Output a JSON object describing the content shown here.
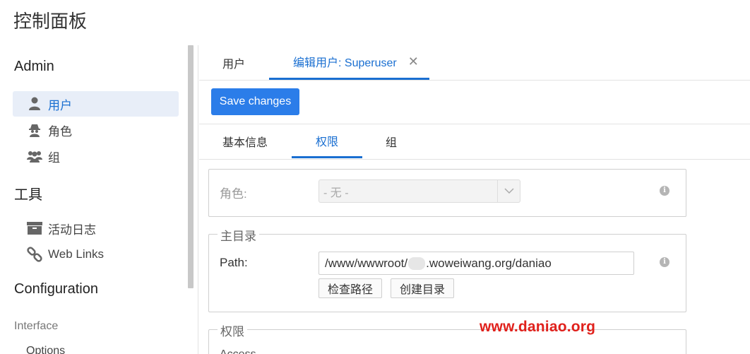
{
  "page": {
    "title": "控制面板"
  },
  "sidebar": {
    "admin_heading": "Admin",
    "items": [
      {
        "label": "用户",
        "icon": "user-icon",
        "active": true
      },
      {
        "label": "角色",
        "icon": "spy-icon",
        "active": false
      },
      {
        "label": "组",
        "icon": "users-icon",
        "active": false
      }
    ],
    "tools_heading": "工具",
    "tool_items": [
      {
        "label": "活动日志",
        "icon": "archive-icon"
      },
      {
        "label": "Web Links",
        "icon": "link-icon"
      }
    ],
    "config_heading": "Configuration",
    "interface_label": "Interface",
    "options_label": "Options"
  },
  "tabs": {
    "users": "用户",
    "edit_user": "编辑用户: Superuser",
    "close_glyph": "✕"
  },
  "toolbar": {
    "save_label": "Save changes"
  },
  "subtabs": {
    "basic": "基本信息",
    "permissions": "权限",
    "groups": "组"
  },
  "role_panel": {
    "label": "角色:",
    "value": "- 无 -"
  },
  "home_panel": {
    "legend": "主目录",
    "path_label": "Path:",
    "path_prefix": "/www/wwwroot/",
    "path_suffix": ".woweiwang.org/daniao",
    "check_button": "检查路径",
    "create_button": "创建目录"
  },
  "perm_panel": {
    "legend": "权限",
    "access_label": "Access"
  },
  "watermark": "www.daniao.org",
  "colors": {
    "accent": "#1a6fd1",
    "button": "#2b7de9",
    "watermark": "#e0201b"
  }
}
